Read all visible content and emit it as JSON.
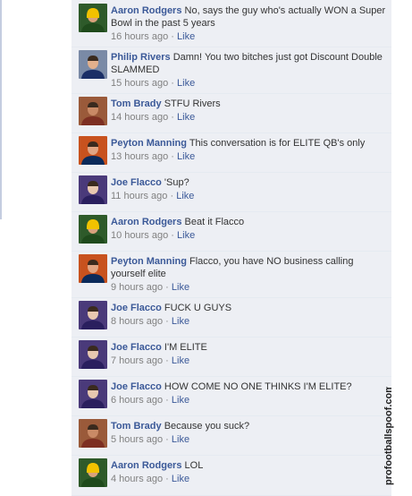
{
  "comments": [
    {
      "author": "Aaron Rodgers",
      "text": "No, says the guy who's actually WON a Super Bowl in the past 5 years",
      "time": "16 hours ago",
      "like": "Like",
      "avatar": "aaron-rodgers"
    },
    {
      "author": "Philip Rivers",
      "text": "Damn! You two bitches just got Discount Double SLAMMED",
      "time": "15 hours ago",
      "like": "Like",
      "avatar": "philip-rivers"
    },
    {
      "author": "Tom Brady",
      "text": "STFU Rivers",
      "time": "14 hours ago",
      "like": "Like",
      "avatar": "tom-brady"
    },
    {
      "author": "Peyton Manning",
      "text": "This conversation is for ELITE QB's only",
      "time": "13 hours ago",
      "like": "Like",
      "avatar": "peyton-manning"
    },
    {
      "author": "Joe Flacco",
      "text": "'Sup?",
      "time": "11 hours ago",
      "like": "Like",
      "avatar": "joe-flacco"
    },
    {
      "author": "Aaron Rodgers",
      "text": "Beat it Flacco",
      "time": "10 hours ago",
      "like": "Like",
      "avatar": "aaron-rodgers"
    },
    {
      "author": "Peyton Manning",
      "text": "Flacco, you have NO business calling yourself elite",
      "time": "9 hours ago",
      "like": "Like",
      "avatar": "peyton-manning"
    },
    {
      "author": "Joe Flacco",
      "text": "FUCK U GUYS",
      "time": "8 hours ago",
      "like": "Like",
      "avatar": "joe-flacco"
    },
    {
      "author": "Joe Flacco",
      "text": "I'M ELITE",
      "time": "7 hours ago",
      "like": "Like",
      "avatar": "joe-flacco"
    },
    {
      "author": "Joe Flacco",
      "text": "HOW COME NO ONE THINKS I'M ELITE?",
      "time": "6 hours ago",
      "like": "Like",
      "avatar": "joe-flacco"
    },
    {
      "author": "Tom Brady",
      "text": "Because you suck?",
      "time": "5 hours ago",
      "like": "Like",
      "avatar": "tom-brady"
    },
    {
      "author": "Aaron Rodgers",
      "text": "LOL",
      "time": "4 hours ago",
      "like": "Like",
      "avatar": "aaron-rodgers"
    }
  ],
  "separator": "·",
  "watermark": "profootballspoof.com"
}
